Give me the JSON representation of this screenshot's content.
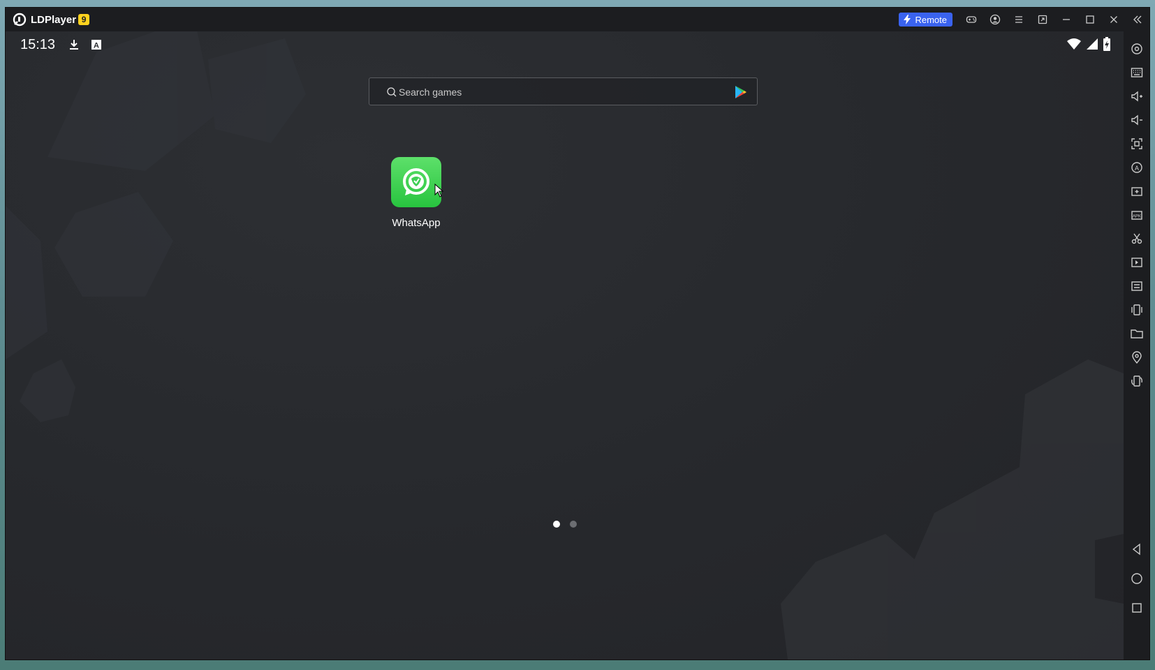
{
  "window": {
    "app_name": "LDPlayer",
    "version_badge": "9",
    "remote_label": "Remote",
    "title_controls": [
      "gamepad-icon",
      "account-icon",
      "menu-icon",
      "sync-icon",
      "minimize-icon",
      "maximize-icon",
      "close-icon",
      "collapse-sidebar-icon"
    ]
  },
  "statusbar": {
    "time": "15:13",
    "left_icons": [
      "download-icon",
      "keyboard-a-icon"
    ],
    "right_icons": [
      "wifi-icon",
      "signal-icon",
      "battery-charging-icon"
    ]
  },
  "search": {
    "placeholder": "Search games",
    "store_icon": "google-play-icon"
  },
  "apps": [
    {
      "label": "WhatsApp",
      "icon": "whatsapp-icon",
      "color": "#25c83f"
    }
  ],
  "pager": {
    "pages": 2,
    "active": 1
  },
  "sidebar": {
    "tools": [
      "settings-icon",
      "keyboard-mapping-icon",
      "volume-up-icon",
      "volume-down-icon",
      "screenshot-icon",
      "auto-operation-icon",
      "add-app-icon",
      "install-apk-icon",
      "cut-icon",
      "record-icon",
      "sync-operation-icon",
      "shake-icon",
      "folder-icon",
      "location-icon",
      "rotate-icon"
    ],
    "nav": [
      "back-icon",
      "home-icon",
      "recents-icon"
    ]
  },
  "colors": {
    "accent": "#3a63f0",
    "badge": "#ffd21e",
    "screen_bg": "#27292d",
    "chrome_bg": "#1c1d20"
  }
}
